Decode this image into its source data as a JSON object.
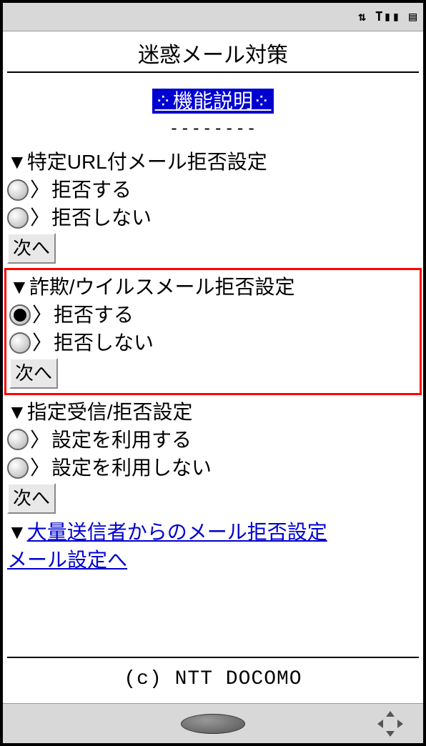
{
  "status": {
    "icons_text": "⇅ T▮▮ ▤"
  },
  "page": {
    "title": "迷惑メール対策",
    "feature_link": "機能説明",
    "dashes": "--------"
  },
  "sections": {
    "url_block": {
      "heading": "特定URL付メール拒否設定",
      "options": [
        "拒否する",
        "拒否しない"
      ],
      "selected": -1,
      "next": "次へ"
    },
    "fraud_virus": {
      "heading": "詐欺/ウイルスメール拒否設定",
      "options": [
        "拒否する",
        "拒否しない"
      ],
      "selected": 0,
      "next": "次へ"
    },
    "allow_block": {
      "heading": "指定受信/拒否設定",
      "options": [
        "設定を利用する",
        "設定を利用しない"
      ],
      "selected": -1,
      "next": "次へ"
    },
    "bulk_sender": {
      "heading_prefix": "▼",
      "link_text": "大量送信者からのメール拒否設定"
    }
  },
  "back_link": "メール設定へ",
  "copyright": "(c) NTT DOCOMO"
}
